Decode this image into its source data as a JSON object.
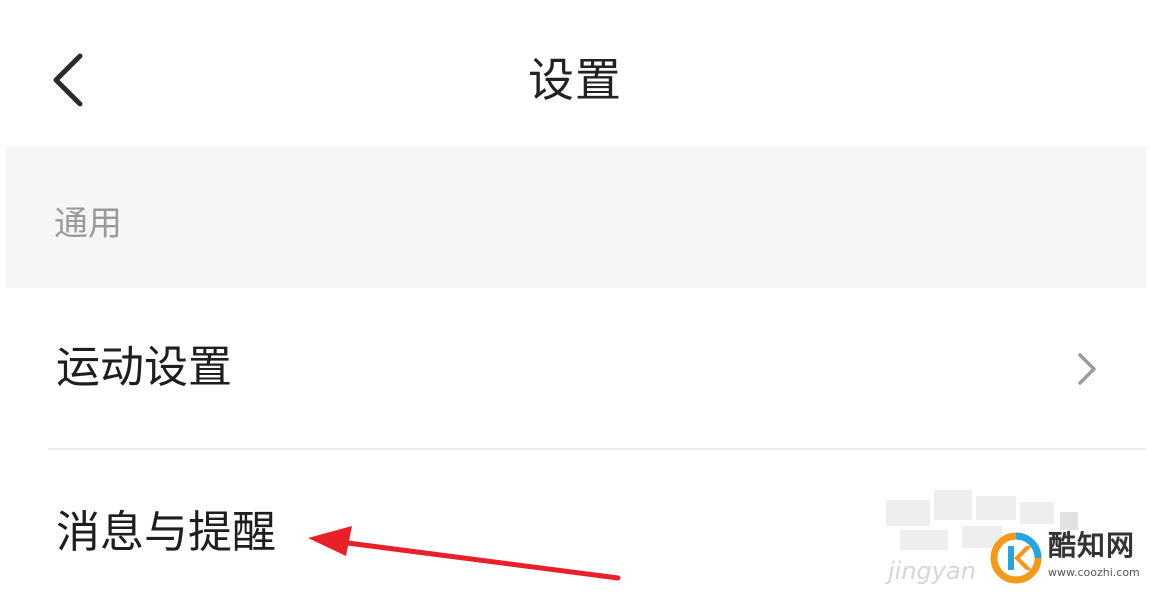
{
  "header": {
    "title": "设置",
    "back_icon": "chevron-left-icon"
  },
  "section": {
    "label": "通用"
  },
  "items": [
    {
      "label": "运动设置",
      "icon": "chevron-right-icon"
    },
    {
      "label": "消息与提醒"
    }
  ],
  "watermark": {
    "name": "酷知网",
    "url": "www.coozhi.com",
    "partial_text": "jingyan"
  },
  "colors": {
    "background": "#ffffff",
    "section_background": "#f6f6f6",
    "title_text": "#222222",
    "section_text": "#9a9a9a",
    "item_text": "#1e1e1e",
    "chevron": "#9b9b9b",
    "annotation_arrow": "#e8202a",
    "logo_orange": "#f39a1e",
    "logo_blue": "#29a3dd"
  }
}
